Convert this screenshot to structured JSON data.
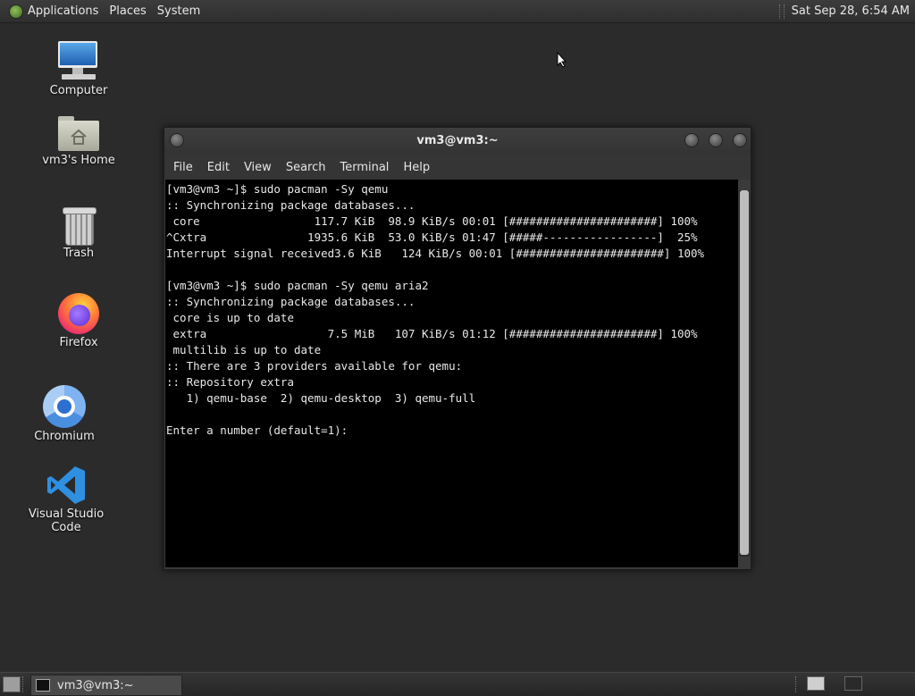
{
  "top_panel": {
    "menus": [
      "Applications",
      "Places",
      "System"
    ],
    "clock": "Sat Sep 28,  6:54 AM"
  },
  "desktop": {
    "icons": [
      {
        "label": "Computer",
        "icon": "computer-icon"
      },
      {
        "label": "vm3's Home",
        "icon": "home-folder-icon"
      },
      {
        "label": "Trash",
        "icon": "trash-icon"
      },
      {
        "label": "Firefox",
        "icon": "firefox-icon"
      },
      {
        "label": "Chromium",
        "icon": "chromium-icon"
      },
      {
        "label": "Visual Studio Code",
        "icon": "vscode-icon"
      }
    ]
  },
  "terminal": {
    "title": "vm3@vm3:~",
    "menu": [
      "File",
      "Edit",
      "View",
      "Search",
      "Terminal",
      "Help"
    ],
    "lines": [
      "[vm3@vm3 ~]$ sudo pacman -Sy qemu",
      ":: Synchronizing package databases...",
      " core                 117.7 KiB  98.9 KiB/s 00:01 [######################] 100%",
      "^Cxtra               1935.6 KiB  53.0 KiB/s 01:47 [#####-----------------]  25%",
      "Interrupt signal received3.6 KiB   124 KiB/s 00:01 [######################] 100%",
      "",
      "[vm3@vm3 ~]$ sudo pacman -Sy qemu aria2",
      ":: Synchronizing package databases...",
      " core is up to date",
      " extra                  7.5 MiB   107 KiB/s 01:12 [######################] 100%",
      " multilib is up to date",
      ":: There are 3 providers available for qemu:",
      ":: Repository extra",
      "   1) qemu-base  2) qemu-desktop  3) qemu-full",
      "",
      "Enter a number (default=1): "
    ]
  },
  "bottom_panel": {
    "task_label": "vm3@vm3:~",
    "workspaces": 2,
    "active_workspace": 1
  },
  "colors": {
    "desktop_bg": "#2b2b2b",
    "terminal_bg": "#000000",
    "terminal_fg": "#e8e8e8"
  }
}
